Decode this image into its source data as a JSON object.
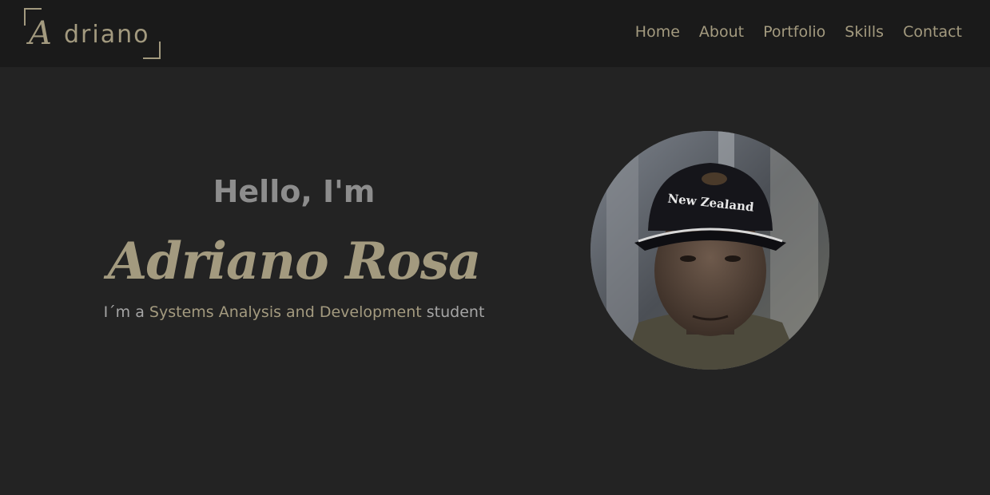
{
  "brand": {
    "logo_initial": "A",
    "logo_rest": "driano"
  },
  "nav": {
    "items": [
      {
        "label": "Home"
      },
      {
        "label": "About"
      },
      {
        "label": "Portfolio"
      },
      {
        "label": "Skills"
      },
      {
        "label": "Contact"
      }
    ]
  },
  "hero": {
    "greeting": "Hello, I'm",
    "name": "Adriano Rosa",
    "tagline_prefix": "I´m a ",
    "tagline_highlight": "Systems Analysis and Development",
    "tagline_suffix": " student"
  },
  "avatar": {
    "cap_text": "New Zealand"
  },
  "colors": {
    "accent": "#a39a7f",
    "background": "#232323",
    "navbar": "#1a1a1a",
    "greeting": "#8d8d8d"
  }
}
